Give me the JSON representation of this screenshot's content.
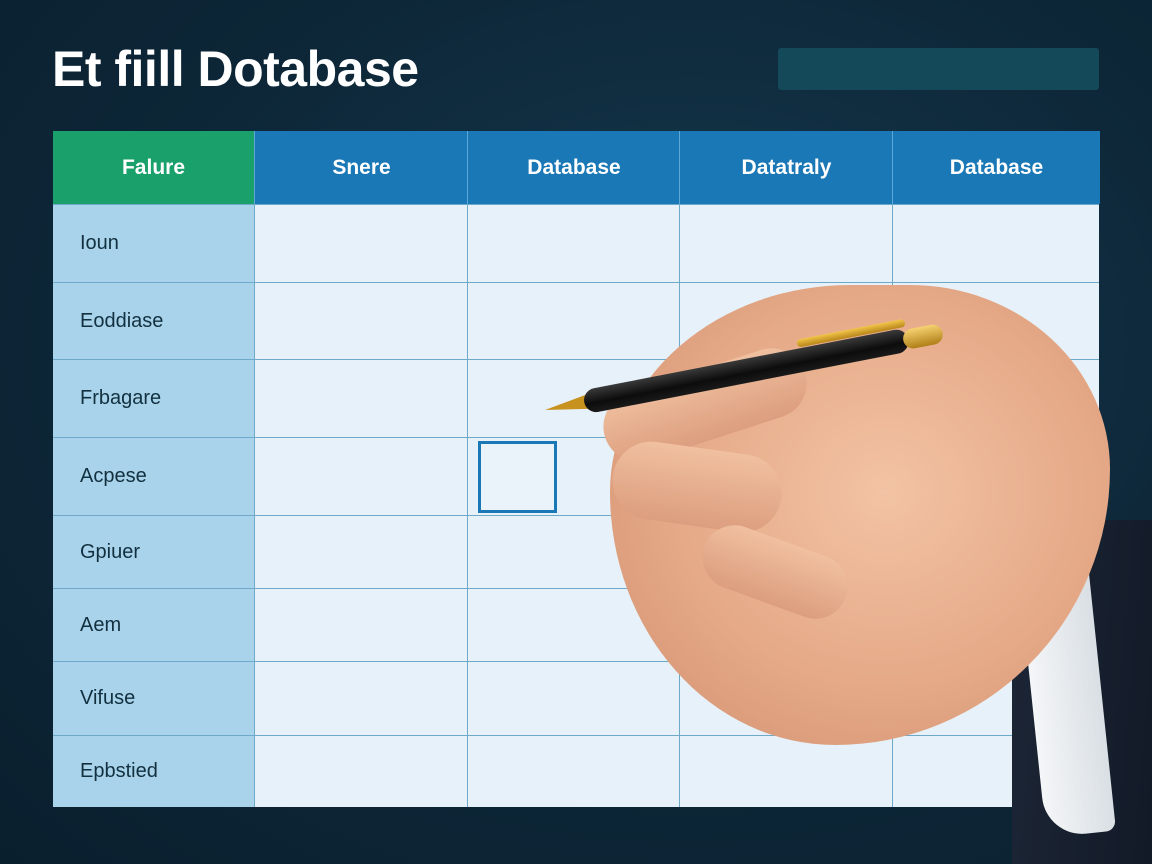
{
  "header": {
    "title": "Et fiill Dotabase"
  },
  "table": {
    "columns": [
      "Falure",
      "Snere",
      "Database",
      "Datatraly",
      "Database"
    ],
    "rows": [
      "Ioun",
      "Eoddiase",
      "Frbagare",
      "Acpese",
      "Gpiuer",
      "Aem",
      "Vifuse",
      "Epbstied"
    ]
  },
  "colors": {
    "header_green": "#1aa06b",
    "header_blue": "#1a78b6",
    "row_label_bg": "#a9d3ea",
    "highlight_border": "#1a78b6"
  },
  "icons": {
    "pen": "pen-icon",
    "hand": "hand-image"
  }
}
